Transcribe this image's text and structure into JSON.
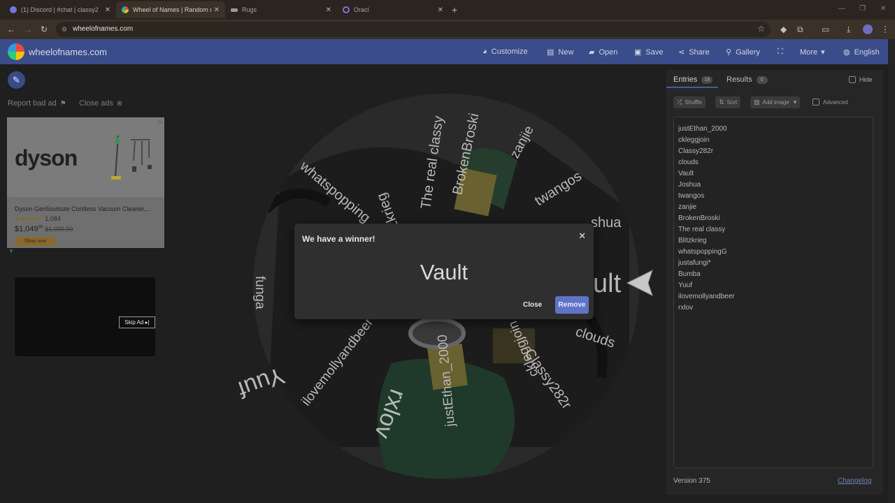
{
  "browser": {
    "tabs": [
      {
        "title": "(1) Discord | #chat | classy2",
        "favicon_color": "#7078d8"
      },
      {
        "title": "Wheel of Names | Random nam",
        "favicon_color": "#d84a3a"
      },
      {
        "title": "Rugs",
        "favicon_color": "#9a9a9a"
      },
      {
        "title": "Oracl",
        "favicon_color": "#8a6ad8"
      }
    ],
    "url": "wheelofnames.com"
  },
  "site": {
    "logo_text": "wheelofnames.com",
    "menu": {
      "customize": "Customize",
      "new": "New",
      "open": "Open",
      "save": "Save",
      "share": "Share",
      "gallery": "Gallery",
      "more": "More",
      "language": "English"
    }
  },
  "ads": {
    "report": "Report bad ad",
    "close": "Close ads",
    "brand": "dyson",
    "title": "Dyson Gen5outsize Cordless Vacuum Cleaner,...",
    "rating_count": "1,084",
    "price": "$1,049",
    "price_cents": "00",
    "old_price": "$1,099.99",
    "cta": "Shop now",
    "skip": "Skip Ad ▸|"
  },
  "wheel": {
    "labels": [
      "justEthan_2000",
      "ckleggjoin",
      "Classy282r",
      "clouds",
      "Vault",
      "Joshua",
      "twangos",
      "zanjie",
      "BrokenBroski",
      "The real classy",
      "Blitzkrieg",
      "whatspoppingG",
      "justafungi*",
      "Bumba",
      "Yuuf",
      "ilovemollyandbeer",
      "rxlov"
    ],
    "visible_labels": {
      "justethan": "justEthan_2000",
      "ckleggjoin": "ckleggjoin",
      "classy": "Classy282r",
      "clouds": "clouds",
      "vault": "ult",
      "joshua": "shua",
      "twangos": "twangos",
      "zanjie": "zanjie",
      "broken": "BrokenBroski",
      "realclassy": "The real classy",
      "blitz": "Blitzkrieg",
      "whatspopping": "whatspopping",
      "funga": "funga",
      "yuuf": "Yuuf",
      "ilovemolly": "ilovemollyandbeer",
      "rxlov": "rxlov"
    },
    "center_color": "#2f7a4a"
  },
  "panel": {
    "entries_tab": "Entries",
    "entries_count": "18",
    "results_tab": "Results",
    "results_count": "0",
    "hide": "Hide",
    "shuffle": "Shuffle",
    "sort": "Sort",
    "add_image": "Add image",
    "advanced": "Advanced",
    "entries": [
      "justEthan_2000",
      "ckleggjoin",
      "Classy282r",
      "clouds",
      "Vault",
      "Joshua",
      "twangos",
      "zanjie",
      "BrokenBroski",
      "The real classy",
      "Blitzkrieg",
      "whatspoppingG",
      "justafungi*",
      "Bumba",
      "Yuuf",
      "ilovemollyandbeer",
      "rxlov"
    ],
    "version": "Version 375",
    "changelog": "Changelog"
  },
  "modal": {
    "title": "We have a winner!",
    "winner": "Vault",
    "close": "Close",
    "remove": "Remove"
  }
}
